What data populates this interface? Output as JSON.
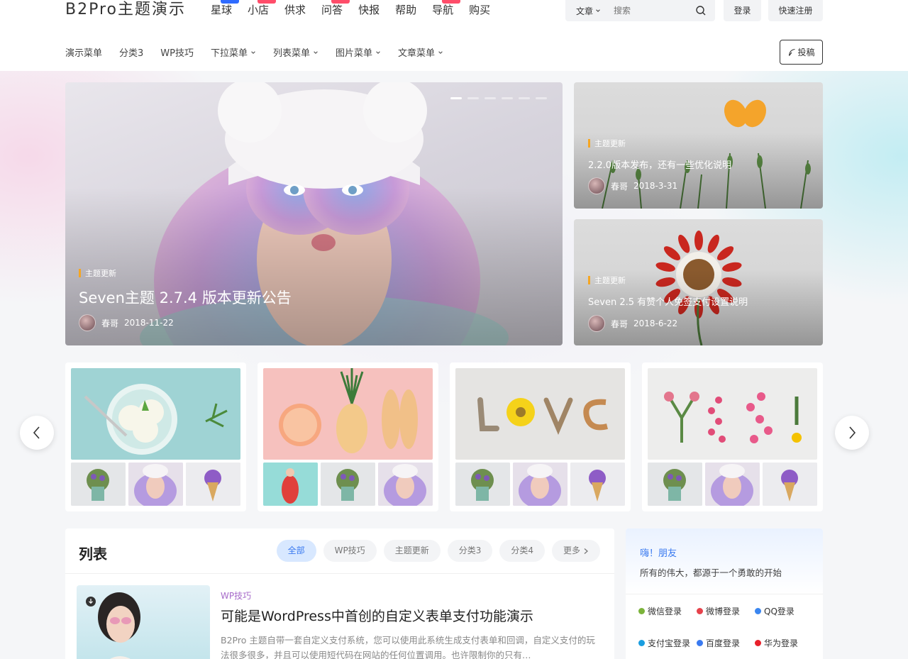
{
  "site": {
    "logo": "B2Pro主题演示"
  },
  "topnav": [
    {
      "label": "星球",
      "badge": "",
      "badge_color": "#2f6bff"
    },
    {
      "label": "小店",
      "badge": "",
      "badge_color": "#ff4d6a"
    },
    {
      "label": "供求",
      "badge": "",
      "badge_color": ""
    },
    {
      "label": "问答",
      "badge": "",
      "badge_color": "#ff4d6a"
    },
    {
      "label": "快报",
      "badge": "",
      "badge_color": ""
    },
    {
      "label": "帮助",
      "badge": "",
      "badge_color": ""
    },
    {
      "label": "导航",
      "badge": "",
      "badge_color": "#ff4d6a"
    },
    {
      "label": "购买",
      "badge": "",
      "badge_color": ""
    }
  ],
  "search": {
    "type_label": "文章",
    "placeholder": "搜索"
  },
  "auth": {
    "login_label": "登录",
    "register_label": "快速注册"
  },
  "subnav": [
    {
      "label": "演示菜单",
      "has_dropdown": false
    },
    {
      "label": "分类3",
      "has_dropdown": false
    },
    {
      "label": "WP技巧",
      "has_dropdown": false
    },
    {
      "label": "下拉菜单",
      "has_dropdown": true
    },
    {
      "label": "列表菜单",
      "has_dropdown": true
    },
    {
      "label": "图片菜单",
      "has_dropdown": true
    },
    {
      "label": "文章菜单",
      "has_dropdown": true
    }
  ],
  "post_button_label": "投稿",
  "hero": {
    "main": {
      "category": "主题更新",
      "title": "Seven主题 2.7.4 版本更新公告",
      "author": "春哥",
      "date": "2018-11-22"
    },
    "side": [
      {
        "category": "主题更新",
        "title": "2.2.0版本发布，还有一些优化说明",
        "author": "春哥",
        "date": "2018-3-31"
      },
      {
        "category": "主题更新",
        "title": "Seven 2.5 有赞个人免签支付设置说明",
        "author": "春哥",
        "date": "2018-6-22"
      }
    ],
    "slide_count": 6,
    "active_slide": 1
  },
  "carousel": {
    "cards": 4
  },
  "list": {
    "title": "列表",
    "filters": [
      {
        "label": "全部",
        "active": true
      },
      {
        "label": "WP技巧",
        "active": false
      },
      {
        "label": "主题更新",
        "active": false
      },
      {
        "label": "分类3",
        "active": false
      },
      {
        "label": "分类4",
        "active": false
      },
      {
        "label": "更多",
        "active": false
      }
    ],
    "post": {
      "category": "WP技巧",
      "title": "可能是WordPress中首创的自定义表单支付功能演示",
      "excerpt": "B2Pro 主题自带一套自定义支付系统，您可以使用此系统生成支付表单和回调，自定义支付的玩法很多很多，并且可以使用短代码在网站的任何位置调用。也许限制你的只有…"
    }
  },
  "sidebar": {
    "greeting": "嗨！朋友",
    "motto": "所有的伟大，都源于一个勇敢的开始",
    "logins": [
      {
        "label": "微信登录",
        "color": "#7bb33a"
      },
      {
        "label": "微博登录",
        "color": "#e6424b"
      },
      {
        "label": "QQ登录",
        "color": "#3a86f0"
      },
      {
        "label": "支付宝登录",
        "color": "#1a9ee0"
      },
      {
        "label": "百度登录",
        "color": "#3a7af0"
      },
      {
        "label": "华为登录",
        "color": "#e8202a"
      }
    ]
  }
}
